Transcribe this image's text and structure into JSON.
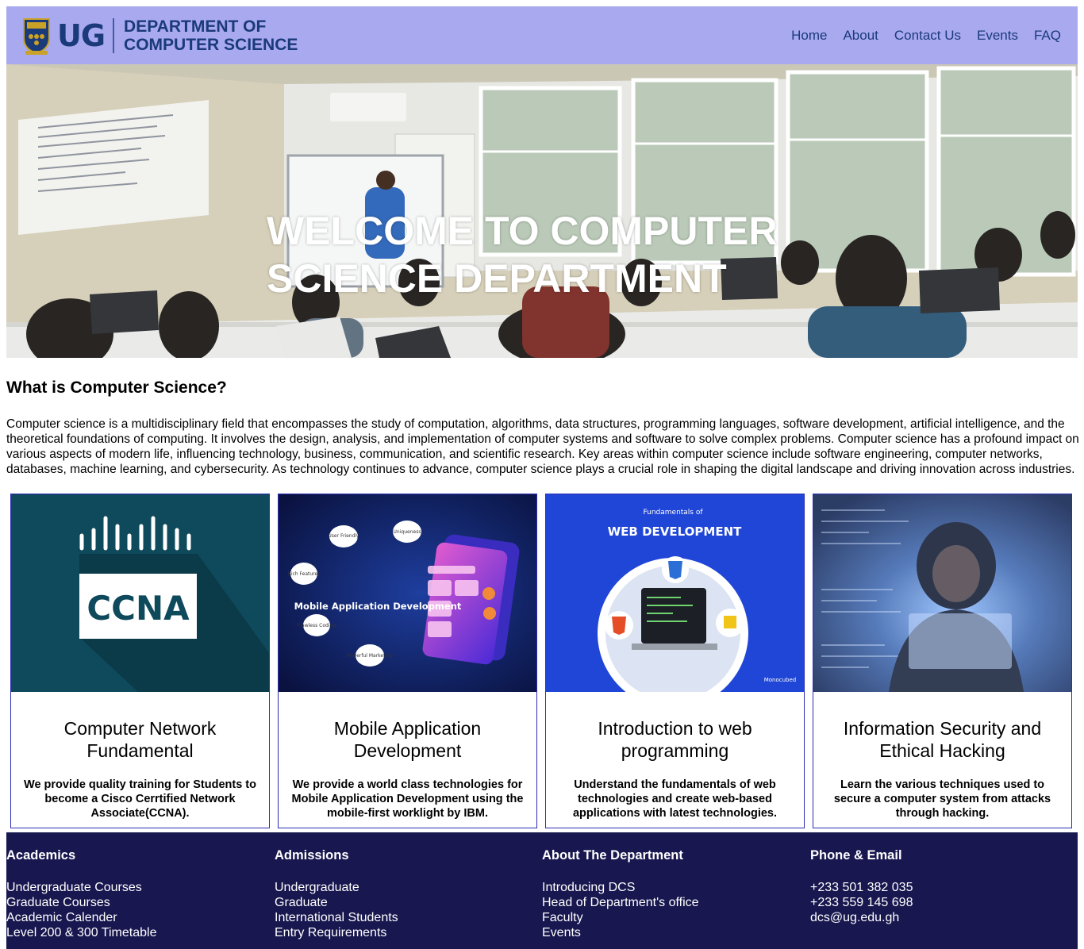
{
  "header": {
    "logo_mark": "UG",
    "logo_line1": "DEPARTMENT OF",
    "logo_line2": "COMPUTER SCIENCE",
    "nav": [
      "Home",
      "About",
      "Contact Us",
      "Events",
      "FAQ"
    ]
  },
  "hero": {
    "title_line1": "WELCOME TO COMPUTER",
    "title_line2": "SCIENCE DEPARTMENT"
  },
  "main": {
    "heading": "What is Computer Science?",
    "intro": "Computer science is a multidisciplinary field that encompasses the study of computation, algorithms, data structures, programming languages, software development, artificial intelligence, and the theoretical foundations of computing. It involves the design, analysis, and implementation of computer systems and software to solve complex problems. Computer science has a profound impact on various aspects of modern life, influencing technology, business, communication, and scientific research. Key areas within computer science include software engineering, computer networks, databases, machine learning, and cybersecurity. As technology continues to advance, computer science plays a crucial role in shaping the digital landscape and driving innovation across industries."
  },
  "cards": [
    {
      "title": "Computer Network Fundamental",
      "desc": "We provide quality training for Students to become a Cisco Cerrtified Network Associate(CCNA).",
      "image_text": "CCNA"
    },
    {
      "title": "Mobile Application Development",
      "desc": "We provide a world class technologies for Mobile Application Development using the mobile-first worklight by IBM.",
      "image_text": "Mobile Application Development",
      "image_bubbles": [
        "User Friendly",
        "Uniqueness",
        "Rich Features",
        "Flawless Coding",
        "Powerful Marketing"
      ]
    },
    {
      "title": "Introduction to web programming",
      "desc": "Understand the fundamentals of web technologies and create web-based applications with latest technologies.",
      "image_caption": "Fundamentals of",
      "image_text": "WEB DEVELOPMENT",
      "image_brand": "Monocubed"
    },
    {
      "title": "Information Security and Ethical Hacking",
      "desc": "Learn the various techniques used to secure a computer system from attacks through hacking."
    }
  ],
  "footer": {
    "columns": [
      {
        "title": "Academics",
        "items": [
          "Undergraduate Courses",
          "Graduate Courses",
          "Academic Calender",
          "Level 200 & 300 Timetable"
        ]
      },
      {
        "title": "Admissions",
        "items": [
          "Undergraduate",
          "Graduate",
          "International Students",
          "Entry Requirements"
        ]
      },
      {
        "title": "About The Department",
        "items": [
          "Introducing DCS",
          "Head of Department's office",
          "Faculty",
          "Events"
        ]
      },
      {
        "title": "Phone & Email",
        "items": [
          "+233 501 382 035",
          "+233 559 145 698",
          "dcs@ug.edu.gh"
        ]
      }
    ]
  },
  "colors": {
    "header_bg": "#a9a9f0",
    "brand_blue": "#1a3a7a",
    "card_border": "#2d2db5",
    "footer_bg": "#18174f"
  }
}
